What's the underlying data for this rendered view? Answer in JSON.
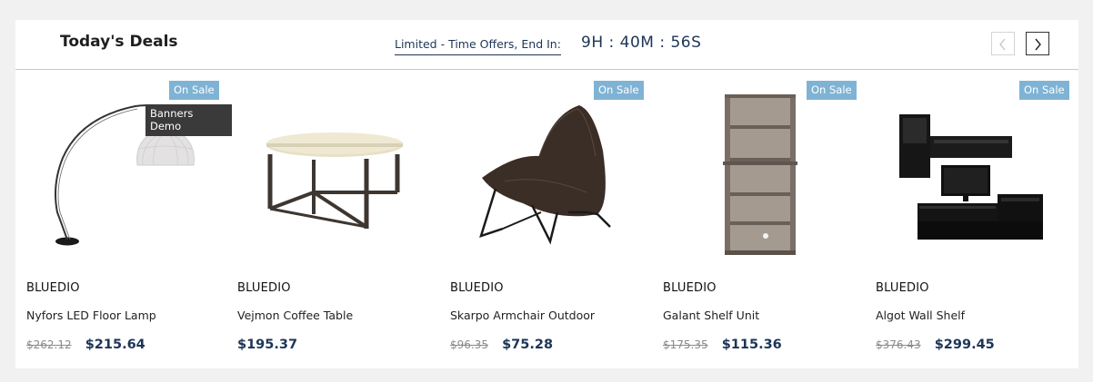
{
  "header": {
    "title": "Today's Deals",
    "offer_label": "Limited - Time Offers, End In:",
    "countdown": "9H : 40M : 56S"
  },
  "navigation": {
    "prev_icon": "chevron-left-icon",
    "next_icon": "chevron-right-icon"
  },
  "colors": {
    "accent": "#1d3557",
    "sale_badge": "#7fb3d5",
    "tooltip": "#3a3a3a"
  },
  "tooltip": {
    "text": "Banners Demo"
  },
  "products": [
    {
      "badge": "On Sale",
      "brand": "BLUEDIO",
      "name": "Nyfors LED Floor Lamp",
      "old_price": "$262.12",
      "price": "$215.64"
    },
    {
      "badge": "",
      "brand": "BLUEDIO",
      "name": "Vejmon Coffee Table",
      "old_price": "",
      "price": "$195.37"
    },
    {
      "badge": "On Sale",
      "brand": "BLUEDIO",
      "name": "Skarpo Armchair Outdoor",
      "old_price": "$96.35",
      "price": "$75.28"
    },
    {
      "badge": "On Sale",
      "brand": "BLUEDIO",
      "name": "Galant Shelf Unit",
      "old_price": "$175.35",
      "price": "$115.36"
    },
    {
      "badge": "On Sale",
      "brand": "BLUEDIO",
      "name": "Algot Wall Shelf",
      "old_price": "$376.43",
      "price": "$299.45"
    }
  ]
}
